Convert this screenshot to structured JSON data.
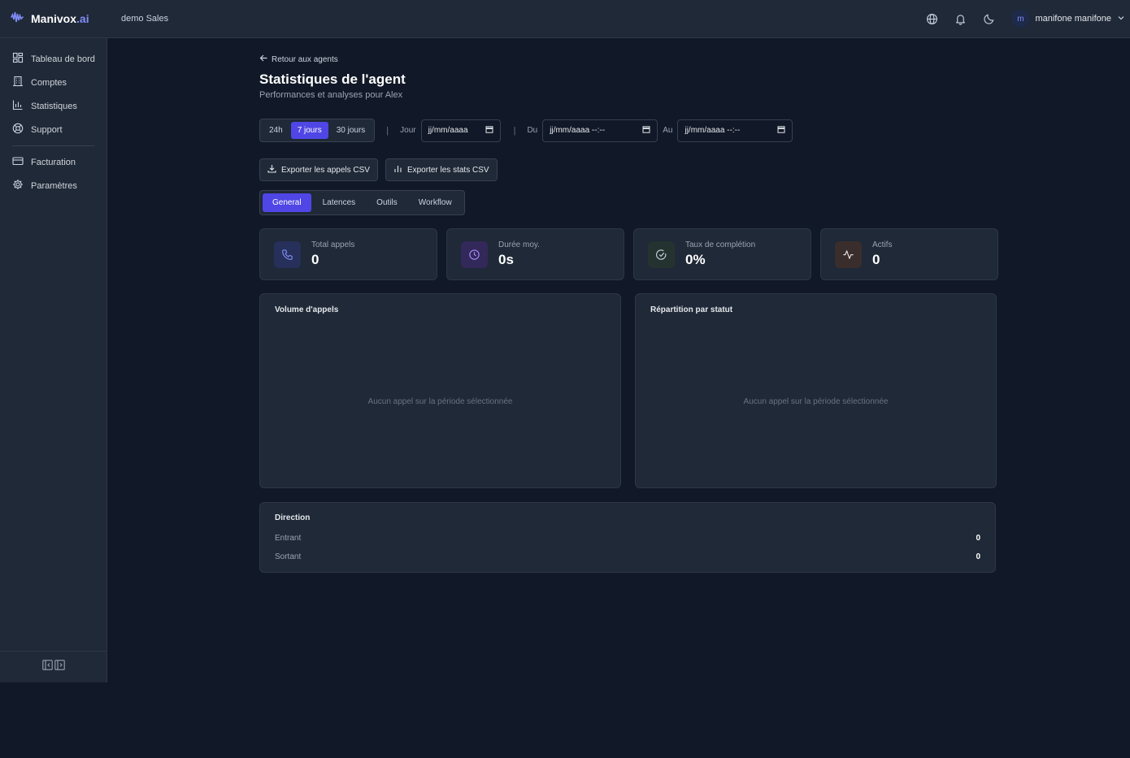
{
  "app": {
    "brand_name": "Manivox",
    "brand_suffix": ".ai",
    "workspace": "demo Sales"
  },
  "header": {
    "user_initial": "m",
    "user_name": "manifone manifone"
  },
  "sidebar": {
    "items": [
      {
        "label": "Tableau de bord",
        "icon": "dashboard-icon"
      },
      {
        "label": "Comptes",
        "icon": "building-icon"
      },
      {
        "label": "Statistiques",
        "icon": "bar-chart-icon"
      },
      {
        "label": "Support",
        "icon": "lifebuoy-icon"
      },
      {
        "label": "Facturation",
        "icon": "credit-card-icon"
      },
      {
        "label": "Paramètres",
        "icon": "gear-icon"
      }
    ]
  },
  "page": {
    "back_label": "Retour aux agents",
    "title": "Statistiques de l'agent",
    "subtitle": "Performances et analyses pour Alex"
  },
  "filters": {
    "ranges": [
      "24h",
      "7 jours",
      "30 jours"
    ],
    "active_range": "7 jours",
    "day_label": "Jour",
    "day_value": "jj/mm/aaaa",
    "from_label": "Du",
    "from_value": "jj/mm/aaaa --:--",
    "to_label": "Au",
    "to_value": "jj/mm/aaaa --:--"
  },
  "exports": {
    "calls_csv": "Exporter les appels CSV",
    "stats_csv": "Exporter les stats CSV"
  },
  "tabs": [
    "General",
    "Latences",
    "Outils",
    "Workflow"
  ],
  "active_tab": "General",
  "kpis": [
    {
      "label": "Total appels",
      "value": "0",
      "icon": "phone-icon",
      "color": "#818cf8"
    },
    {
      "label": "Durée moy.",
      "value": "0s",
      "icon": "clock-icon",
      "color": "#a78bfa"
    },
    {
      "label": "Taux de complétion",
      "value": "0%",
      "icon": "check-circle-icon",
      "color": "#9ca3af"
    },
    {
      "label": "Actifs",
      "value": "0",
      "icon": "activity-icon",
      "color": "#e5e7eb"
    }
  ],
  "panels": {
    "volume_title": "Volume d'appels",
    "status_title": "Répartition par statut",
    "empty_message": "Aucun appel sur la période sélectionnée"
  },
  "direction": {
    "title": "Direction",
    "rows": [
      {
        "label": "Entrant",
        "value": "0"
      },
      {
        "label": "Sortant",
        "value": "0"
      }
    ]
  },
  "colors": {
    "accent": "#4f46e5",
    "background": "#111827",
    "surface": "#1f2937"
  }
}
